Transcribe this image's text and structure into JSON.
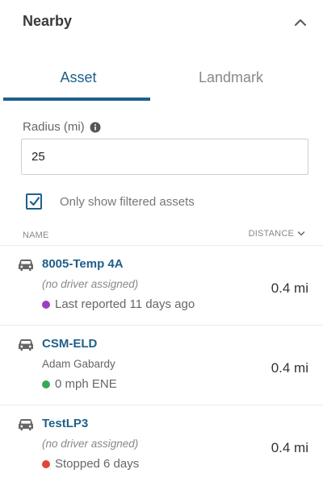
{
  "panel": {
    "title": "Nearby"
  },
  "tabs": [
    {
      "label": "Asset",
      "active": true
    },
    {
      "label": "Landmark",
      "active": false
    }
  ],
  "radius": {
    "label": "Radius (mi)",
    "value": "25"
  },
  "filter": {
    "label": "Only show filtered assets",
    "checked": true
  },
  "columns": {
    "name": "NAME",
    "distance": "DISTANCE"
  },
  "assets": [
    {
      "name": "8005-Temp 4A",
      "driver": "(no driver assigned)",
      "status": "Last reported 11 days ago",
      "status_color": "#9b3fbf",
      "distance": "0.4 mi"
    },
    {
      "name": "CSM-ELD",
      "driver": "Adam Gabardy",
      "status": "0 mph ENE",
      "status_color": "#3aa757",
      "distance": "0.4 mi"
    },
    {
      "name": "TestLP3",
      "driver": "(no driver assigned)",
      "status": "Stopped 6 days",
      "status_color": "#e2463a",
      "distance": "0.4 mi"
    }
  ],
  "colors": {
    "accent": "#1f5f8b"
  }
}
